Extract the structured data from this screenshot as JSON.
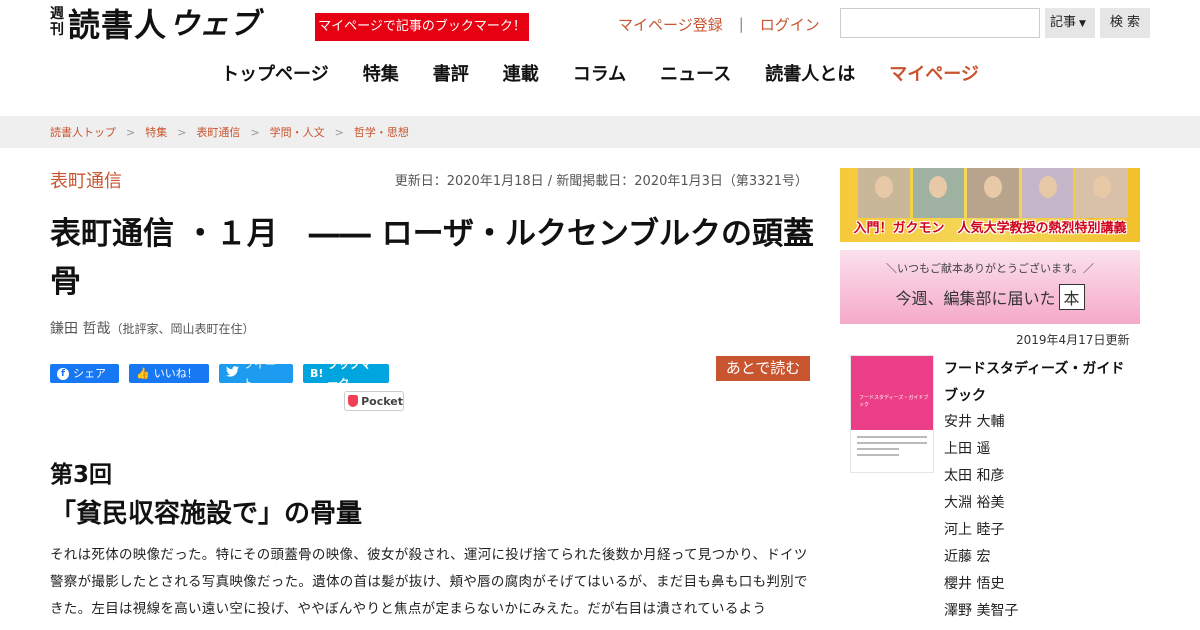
{
  "header": {
    "logo_small_top": "週",
    "logo_small_bottom": "刊",
    "logo_main": "読書人",
    "logo_web": "ウェブ",
    "mypage_promo": "マイページで記事のブックマーク！",
    "register_link": "マイページ登録",
    "separator": "|",
    "login_link": "ログイン",
    "search_input_value": "",
    "search_scope": "記事",
    "search_button": "検 索"
  },
  "nav": {
    "items": [
      {
        "label": "トップページ"
      },
      {
        "label": "特集"
      },
      {
        "label": "書評"
      },
      {
        "label": "連載"
      },
      {
        "label": "コラム"
      },
      {
        "label": "ニュース"
      },
      {
        "label": "読書人とは"
      },
      {
        "label": "マイページ"
      }
    ]
  },
  "breadcrumb": [
    "読書人トップ",
    "特集",
    "表町通信",
    "学問・人文",
    "哲学・思想"
  ],
  "article": {
    "category": "表町通信",
    "dates": "更新日：2020年1月18日 / 新聞掲載日：2020年1月3日（第3321号）",
    "title": "表町通信 ・１月　―― ローザ・ルクセンブルクの頭蓋骨",
    "author_name": "鎌田 哲哉",
    "author_note": "（批評家、岡山表町在住）",
    "read_later": "あとで読む",
    "episode": "第3回",
    "subhead": "「貧民収容施設で」の骨量",
    "body": "それは死体の映像だった。特にその頭蓋骨の映像、彼女が殺され、運河に投げ捨てられた後数か月経って見つかり、ドイツ警察が撮影したとされる写真映像だった。遺体の首は髪が抜け、頬や唇の腐肉がそげてはいるが、まだ目も鼻も口も判別できた。左目は視線を高い遠い空に投げ、ややぼんやりと焦点が定まらないかにみえた。だが右目は潰されているよう"
  },
  "share": {
    "facebook": "シェア",
    "like": "いいね！",
    "tweet": "ツイート",
    "hatena_mark": "B!",
    "hatena": "ブックマーク",
    "pocket": "Pocket"
  },
  "sidebar": {
    "banner1_text": "入門！ガクモン　人気大学教授の熱烈特別講義",
    "banner2_small": "＼いつもご献本ありがとうございます。／",
    "banner2_big": "今週、編集部に届いた",
    "banner2_book": "本",
    "updated": "2019年4月17日更新",
    "book_title": "フードスタディーズ・ガイドブック",
    "book_cover_text": "フードスタディーズ・ガイドブック",
    "authors": [
      "安井 大輔",
      "上田 遥",
      "太田 和彦",
      "大淵 裕美",
      "河上 睦子",
      "近藤 宏",
      "櫻井 悟史",
      "澤野 美智子"
    ]
  }
}
